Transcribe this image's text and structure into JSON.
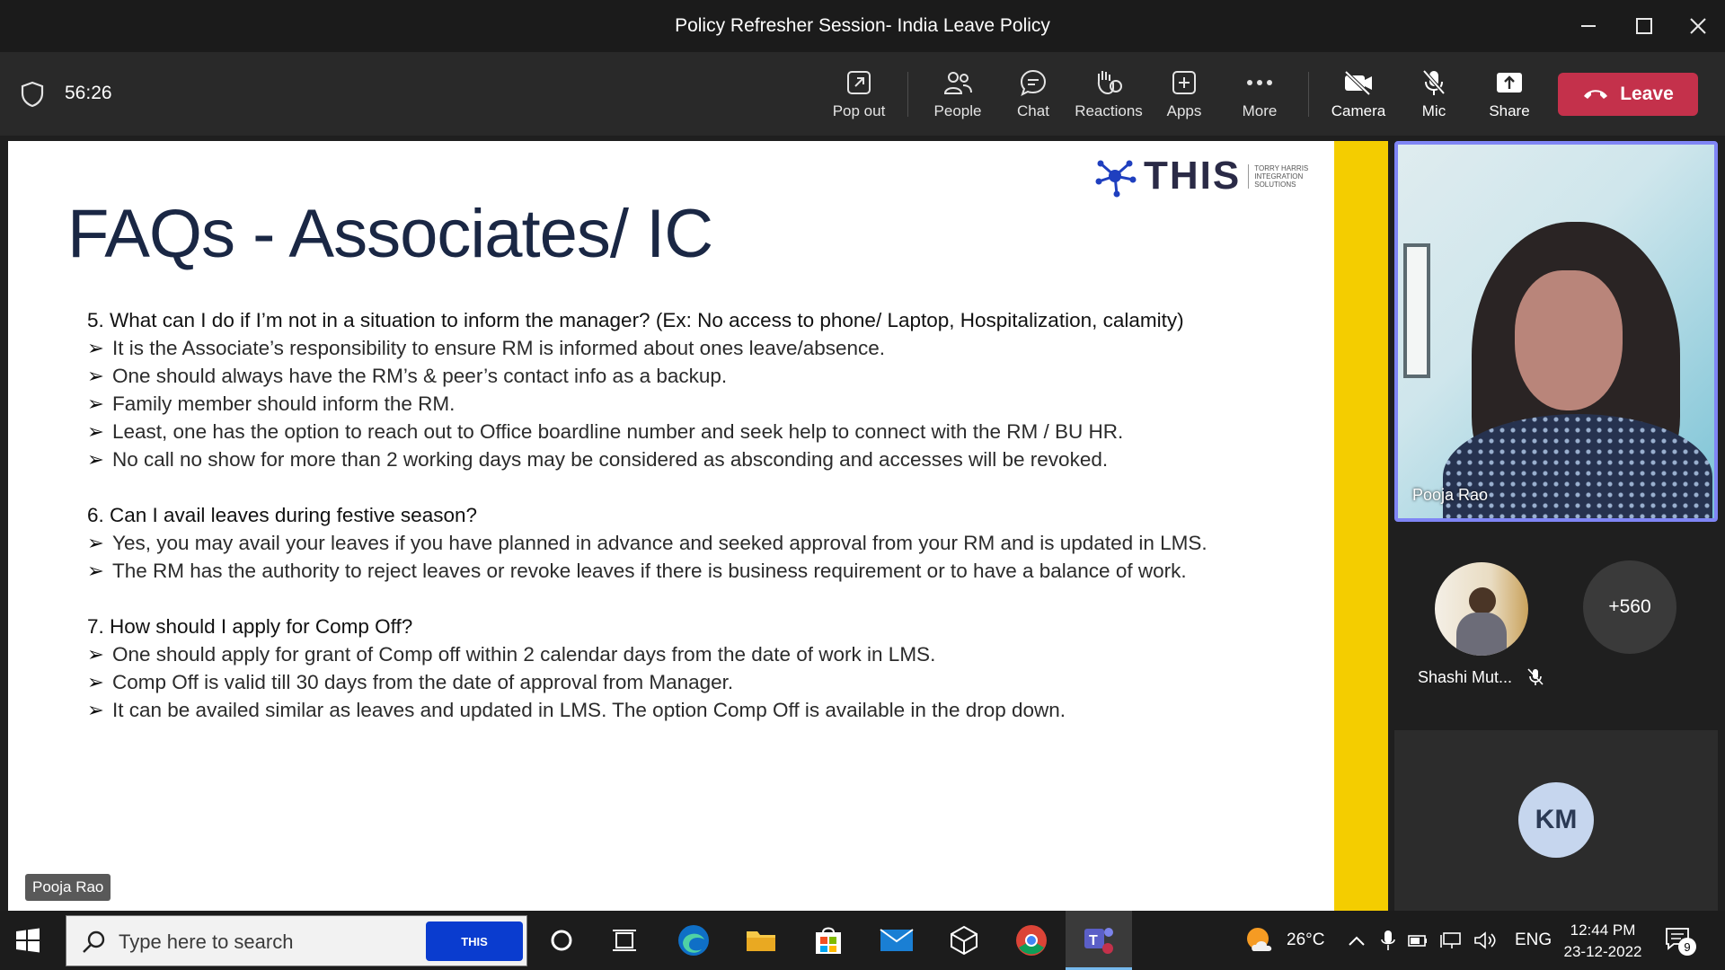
{
  "window": {
    "title": "Policy Refresher Session- India Leave Policy"
  },
  "meeting": {
    "timer": "56:26",
    "buttons": {
      "popout": "Pop out",
      "people": "People",
      "chat": "Chat",
      "reactions": "Reactions",
      "apps": "Apps",
      "more": "More",
      "camera": "Camera",
      "mic": "Mic",
      "share": "Share",
      "leave": "Leave"
    }
  },
  "slide": {
    "logo_text": "THIS",
    "logo_tag": [
      "TORRY HARRIS",
      "INTEGRATION",
      "SOLUTIONS"
    ],
    "title": "FAQs - Associates/ IC",
    "sections": [
      {
        "question": "5. What can I do if I’m not in a situation to inform the manager? (Ex: No access to phone/ Laptop, Hospitalization, calamity)",
        "bullets": [
          "It is the Associate’s responsibility to ensure RM is informed about ones leave/absence.",
          "One should always have the RM’s & peer’s contact info as a backup.",
          "Family member should inform the RM.",
          "Least, one has the option to reach out to Office boardline number and seek help to connect with the RM / BU HR.",
          "No call no show for more than 2 working days may be considered as absconding and accesses will be revoked."
        ]
      },
      {
        "question": "6. Can I avail leaves during festive season?",
        "bullets": [
          "Yes, you may avail your leaves if you have planned in advance and seeked approval from your RM and is updated in LMS.",
          "The RM has the authority to reject leaves or revoke leaves if there is business requirement or to have a balance of work."
        ]
      },
      {
        "question": "7. How should I apply for Comp Off?",
        "bullets": [
          "One should apply for grant of Comp off within 2 calendar days from the date of work in LMS.",
          "Comp Off is valid till 30 days from the date of approval from Manager.",
          "It can be availed similar as leaves and updated in LMS. The option Comp Off is available in the drop down."
        ]
      }
    ],
    "bullet_glyph": "➢",
    "presenter_label": "Pooja Rao"
  },
  "participants": {
    "active_video_name": "Pooja Rao",
    "second_name": "Shashi Mut...",
    "overflow_count": "+560",
    "initials_tile": "KM"
  },
  "taskbar": {
    "search_placeholder": "Type here to search",
    "search_promo": "THIS",
    "weather": "26°C",
    "language": "ENG",
    "time": "12:44 PM",
    "date": "23-12-2022",
    "notification_count": "9"
  },
  "colors": {
    "leave_button": "#c4314b",
    "active_speaker_border": "#7f85f5",
    "slide_accent": "#f4cd00",
    "slide_title": "#1a2744"
  }
}
